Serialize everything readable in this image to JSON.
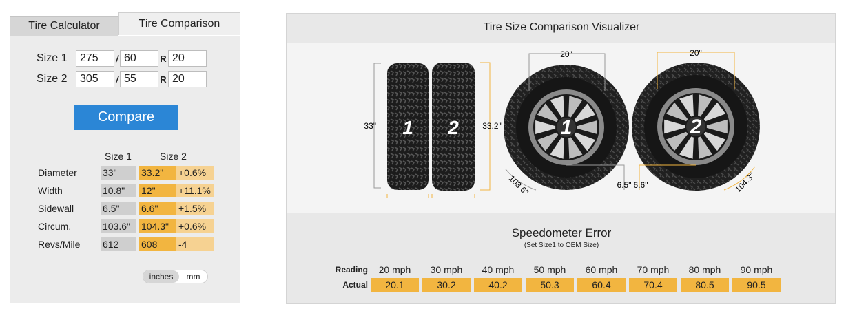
{
  "tabs": {
    "calculator": "Tire Calculator",
    "comparison": "Tire Comparison"
  },
  "size1": {
    "label": "Size 1",
    "width": "275",
    "aspect": "60",
    "rim": "20"
  },
  "size2": {
    "label": "Size 2",
    "width": "305",
    "aspect": "55",
    "rim": "20"
  },
  "sep": "/",
  "r_label": "R",
  "compare_button": "Compare",
  "results": {
    "col1": "Size 1",
    "col2": "Size 2",
    "rows": [
      {
        "label": "Diameter",
        "s1": "33\"",
        "s2": "33.2\"",
        "diff": "+0.6%"
      },
      {
        "label": "Width",
        "s1": "10.8\"",
        "s2": "12\"",
        "diff": "+11.1%"
      },
      {
        "label": "Sidewall",
        "s1": "6.5\"",
        "s2": "6.6\"",
        "diff": "+1.5%"
      },
      {
        "label": "Circum.",
        "s1": "103.6\"",
        "s2": "104.3\"",
        "diff": "+0.6%"
      },
      {
        "label": "Revs/Mile",
        "s1": "612",
        "s2": "608",
        "diff": "-4"
      }
    ]
  },
  "units": {
    "inches": "inches",
    "mm": "mm"
  },
  "visualizer": {
    "title": "Tire Size Comparison Visualizer",
    "tire1_label": "1",
    "tire2_label": "2",
    "dia1": "33\"",
    "dia2": "33.2\"",
    "rim1": "20\"",
    "rim2": "20\"",
    "side1": "6.5\"",
    "side2": "6.6\"",
    "circ1": "103.6\"",
    "circ2": "104.3\""
  },
  "speedo": {
    "title": "Speedometer Error",
    "subtitle": "(Set Size1 to OEM Size)",
    "reading_label": "Reading",
    "actual_label": "Actual",
    "reading": [
      "20 mph",
      "30 mph",
      "40 mph",
      "50 mph",
      "60 mph",
      "70 mph",
      "80 mph",
      "90 mph"
    ],
    "actual": [
      "20.1",
      "30.2",
      "40.2",
      "50.3",
      "60.4",
      "70.4",
      "80.5",
      "90.5"
    ]
  },
  "colors": {
    "accent": "#2b86d6",
    "size2": "#f2b540",
    "size2_light": "#f6d292",
    "size1": "#cfcfcf"
  }
}
